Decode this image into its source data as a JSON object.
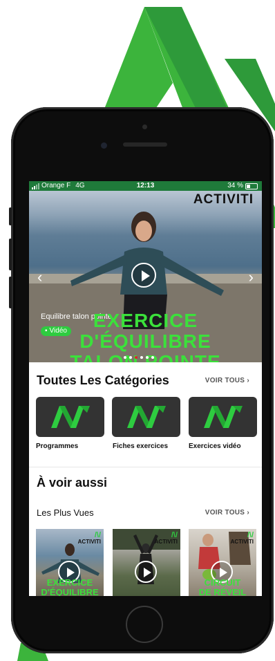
{
  "statusbar": {
    "carrier": "Orange F",
    "network": "4G",
    "time": "12:13",
    "battery": "34 %"
  },
  "hero": {
    "logo": "ACTIVITI",
    "caption": "Equilibre talon pointe",
    "badge": "Vidéo",
    "overlay_line1": "EXERCICE",
    "overlay_line2": "D'ÉQUILIBRE",
    "overlay_line3": "TALON POINTE",
    "slide_count": 6,
    "active_slide": 2
  },
  "categories": {
    "title": "Toutes Les Catégories",
    "see_all": "VOIR TOUS",
    "items": [
      {
        "label": "Programmes"
      },
      {
        "label": "Fiches exercices"
      },
      {
        "label": "Exercices vidéo"
      }
    ]
  },
  "see_also": {
    "title": "À voir aussi",
    "subtitle": "Les Plus Vues",
    "see_all": "VOIR TOUS",
    "thumbs": [
      {
        "logo": "ACTIVITI",
        "text1": "EXERCICE",
        "text2": "D'ÉQUILIBRE"
      },
      {
        "logo": "ACTIVITI",
        "text1": "",
        "text2": ""
      },
      {
        "logo": "ACTIVITI",
        "text1": "CIRCUIT",
        "text2": "DE RÉVEIL"
      }
    ]
  },
  "colors": {
    "brand_green": "#2ecc40",
    "status_green": "#1f7a3a",
    "tile_dark": "#333333"
  }
}
